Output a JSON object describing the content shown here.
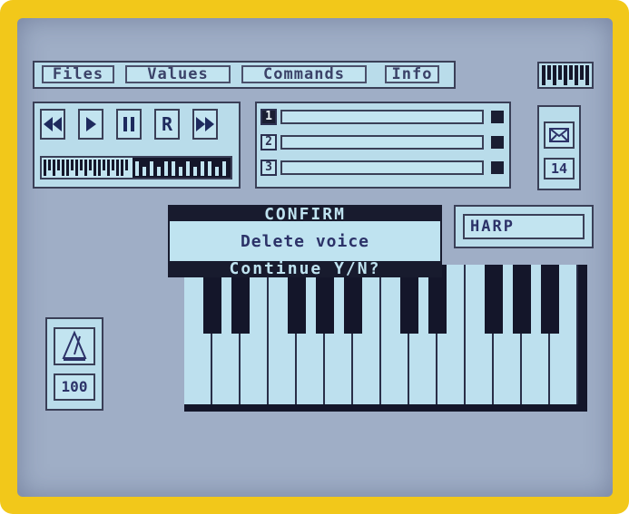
{
  "menu": {
    "files": "Files",
    "values": "Values",
    "commands": "Commands",
    "info": "Info"
  },
  "transport": {
    "rewind_icon": "rewind-icon",
    "play_icon": "play-icon",
    "pause_icon": "pause-icon",
    "record_label": "R",
    "forward_icon": "fast-forward-icon"
  },
  "tracks": [
    {
      "number": "1",
      "selected": true
    },
    {
      "number": "2",
      "selected": false
    },
    {
      "number": "3",
      "selected": false
    }
  ],
  "envelope": {
    "icon": "envelope-icon",
    "value": "14"
  },
  "voice": {
    "name": "HARP"
  },
  "metronome": {
    "icon": "metronome-icon",
    "value": "100"
  },
  "dialog": {
    "title": "CONFIRM",
    "message": "Delete voice",
    "prompt": "Continue Y/N?"
  },
  "colors": {
    "frame": "#f2c81a",
    "screen": "#9faec6",
    "panel": "#b9dcea",
    "dark": "#181b2e"
  }
}
